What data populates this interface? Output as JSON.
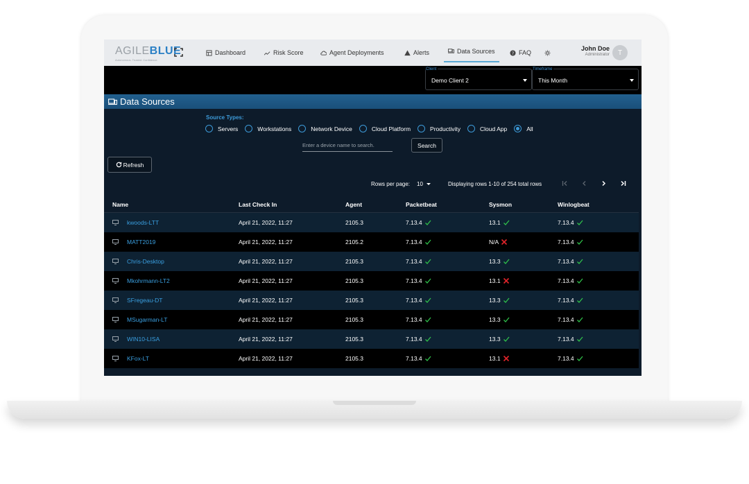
{
  "nav": {
    "logo_agile": "AGILE",
    "logo_blue": "BLUE",
    "logo_tagline": "Autonomous. Trusted. Confidence.",
    "items": [
      {
        "label": "Dashboard",
        "icon": "dashboard-icon"
      },
      {
        "label": "Risk Score",
        "icon": "chart-icon"
      },
      {
        "label": "Agent Deployments",
        "icon": "cloud-icon"
      },
      {
        "label": "Alerts",
        "icon": "warning-icon"
      },
      {
        "label": "Data Sources",
        "icon": "devices-icon",
        "active": true
      },
      {
        "label": "FAQ",
        "icon": "help-icon"
      }
    ],
    "user_name": "John Doe",
    "user_role": "Administrator",
    "avatar_letter": "T"
  },
  "filters": {
    "client_label": "Client",
    "client_value": "Demo Client 2",
    "timeframe_label": "Timeframe",
    "timeframe_value": "This Month"
  },
  "section_title": "Data Sources",
  "source_types": {
    "label": "Source Types:",
    "options": [
      "Servers",
      "Workstations",
      "Network Device",
      "Cloud Platform",
      "Productivity",
      "Cloud App",
      "All"
    ],
    "selected": "All"
  },
  "search": {
    "placeholder": "Enter a device name to search.",
    "button": "Search"
  },
  "refresh_label": "Refresh",
  "pagination": {
    "rows_per_page_label": "Rows per page:",
    "rows_per_page": "10",
    "displaying": "Displaying rows 1-10 of 254 total rows"
  },
  "columns": [
    "Name",
    "Last Check In",
    "Agent",
    "Packetbeat",
    "Sysmon",
    "Winlogbeat"
  ],
  "rows": [
    {
      "name": "kwoods-LTT",
      "last": "April 21, 2022, 11:27",
      "agent": "2105.3",
      "packetbeat": "7.13.4",
      "packetbeat_ok": true,
      "sysmon": "13.1",
      "sysmon_ok": true,
      "winlogbeat": "7.13.4",
      "winlogbeat_ok": true
    },
    {
      "name": "MATT2019",
      "last": "April 21, 2022, 11:27",
      "agent": "2105.2",
      "packetbeat": "7.13.4",
      "packetbeat_ok": true,
      "sysmon": "N/A",
      "sysmon_ok": false,
      "winlogbeat": "7.13.4",
      "winlogbeat_ok": true
    },
    {
      "name": "Chris-Desktop",
      "last": "April 21, 2022, 11:27",
      "agent": "2105.3",
      "packetbeat": "7.13.4",
      "packetbeat_ok": true,
      "sysmon": "13.3",
      "sysmon_ok": true,
      "winlogbeat": "7.13.4",
      "winlogbeat_ok": true
    },
    {
      "name": "Mkohrmann-LT2",
      "last": "April 21, 2022, 11:27",
      "agent": "2105.3",
      "packetbeat": "7.13.4",
      "packetbeat_ok": true,
      "sysmon": "13.1",
      "sysmon_ok": false,
      "winlogbeat": "7.13.4",
      "winlogbeat_ok": true
    },
    {
      "name": "SFregeau-DT",
      "last": "April 21, 2022, 11:27",
      "agent": "2105.3",
      "packetbeat": "7.13.4",
      "packetbeat_ok": true,
      "sysmon": "13.3",
      "sysmon_ok": true,
      "winlogbeat": "7.13.4",
      "winlogbeat_ok": true
    },
    {
      "name": "MSugarman-LT",
      "last": "April 21, 2022, 11:27",
      "agent": "2105.3",
      "packetbeat": "7.13.4",
      "packetbeat_ok": true,
      "sysmon": "13.3",
      "sysmon_ok": true,
      "winlogbeat": "7.13.4",
      "winlogbeat_ok": true
    },
    {
      "name": "WIN10-LISA",
      "last": "April 21, 2022, 11:27",
      "agent": "2105.3",
      "packetbeat": "7.13.4",
      "packetbeat_ok": true,
      "sysmon": "13.3",
      "sysmon_ok": true,
      "winlogbeat": "7.13.4",
      "winlogbeat_ok": true
    },
    {
      "name": "KFox-LT",
      "last": "April 21, 2022, 11:27",
      "agent": "2105.3",
      "packetbeat": "7.13.4",
      "packetbeat_ok": true,
      "sysmon": "13.1",
      "sysmon_ok": false,
      "winlogbeat": "7.13.4",
      "winlogbeat_ok": true
    }
  ],
  "colors": {
    "accent": "#3d9ad8",
    "link": "#3a9fe0",
    "ok": "#2fbf4a",
    "fail": "#e0242a",
    "header_band": "#1f5a87"
  }
}
